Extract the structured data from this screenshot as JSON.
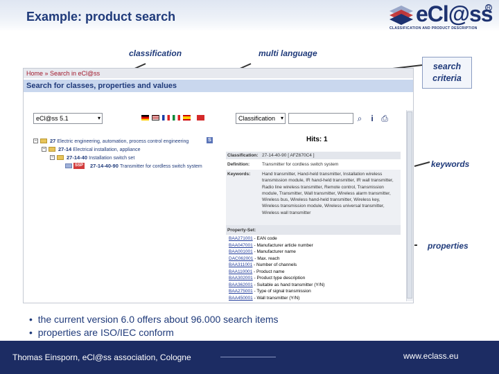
{
  "header": {
    "title": "Example: product search",
    "logo_text": "eCl@ss",
    "logo_sub": "CLASSIFICATION AND PRODUCT DESCRIPTION",
    "logo_reg": "R"
  },
  "callouts": {
    "classification": "classification",
    "multi_language": "multi language",
    "search_criteria_1": "search",
    "search_criteria_2": "criteria",
    "keywords": "keywords",
    "properties": "properties"
  },
  "screen": {
    "breadcrumb": "Home » Search in eCl@ss",
    "section": "Search for classes, properties and values",
    "version_select": "eCl@ss 5.1",
    "search_mode": "Classification",
    "search_value": "",
    "hits": "Hits: 1",
    "tree": [
      {
        "code": "27",
        "label": "Electric engineering, automation, process control engineering"
      },
      {
        "code": "27-14",
        "label": "Electrical installation, appliance"
      },
      {
        "code": "27-14-40",
        "label": "Installation switch set"
      },
      {
        "code": "27-14-40-90",
        "label": "Transmitter for cordless switch system",
        "badge": "SSP"
      }
    ],
    "detail": {
      "classification_label": "Classification:",
      "classification_value": "27-14-40-90 [ AFZ670C4 ]",
      "definition_label": "Definition:",
      "definition_value": "Transmitter for cordless switch system",
      "keywords_label": "Keywords:",
      "keywords_value": "Hand transmitter, Hand-held transmitter, Installation wireless transmission module, IR hand-held transmitter, IR wall transmitter, Radio line wireless transmitter, Remote control, Transmission module, Transmitter, Wall transmitter, Wireless alarm transmitter, Wireless bus, Wireless hand-held transmitter, Wireless key, Wireless transmission module, Wireless universal transmitter, Wireless wall transmitter",
      "propset_label": "Property-Set:",
      "properties": [
        {
          "code": "BAA271001",
          "name": "EAN code"
        },
        {
          "code": "BAA047001",
          "name": "Manufacturer article number"
        },
        {
          "code": "BAA001001",
          "name": "Manufacturer name"
        },
        {
          "code": "DAC062001",
          "name": "Max. reach"
        },
        {
          "code": "BAA311001",
          "name": "Number of channels"
        },
        {
          "code": "BAA110001",
          "name": "Product name"
        },
        {
          "code": "BAA302001",
          "name": "Product type description"
        },
        {
          "code": "BAA362001",
          "name": "Suitable as hand transmitter (Y/N)"
        },
        {
          "code": "BAA275001",
          "name": "Type of signal transmission"
        },
        {
          "code": "BAA450001",
          "name": "Wall transmitter (Y/N)"
        }
      ]
    }
  },
  "bullets": [
    "the current version 6.0 offers about 96.000 search items",
    "properties  are ISO/IEC conform"
  ],
  "footer": {
    "left": "Thomas Einsporn, eCl@ss association, Cologne",
    "right": "www.eclass.eu"
  },
  "colors": {
    "brand": "#1d3270",
    "accent": "#a2192b",
    "footer_bg": "#1c2c63"
  }
}
